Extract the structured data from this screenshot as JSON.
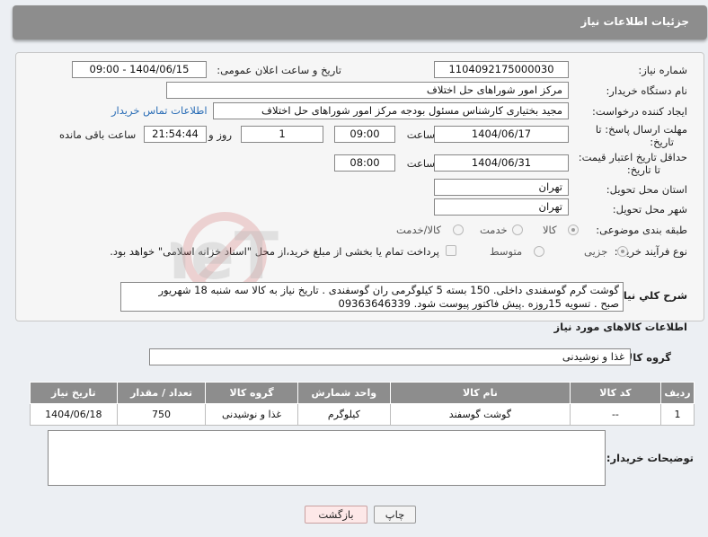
{
  "page_title": "جزئیات اطلاعات نیاز",
  "need_number": {
    "label": "شماره نیاز:",
    "value": "1104092175000030"
  },
  "announce_datetime": {
    "label": "تاریخ و ساعت اعلان عمومی:",
    "value": "1404/06/15 - 09:00"
  },
  "buyer_org": {
    "label": "نام دستگاه خریدار:",
    "value": "مرکز امور شوراهای حل اختلاف"
  },
  "requester": {
    "label": "ایجاد کننده درخواست:",
    "value": "مجید بختیاری کارشناس مسئول بودجه مرکز امور شوراهای حل اختلاف",
    "contact_link": "اطلاعات تماس خریدار"
  },
  "reply_deadline": {
    "label_line1": "مهلت ارسال پاسخ: تا",
    "label_line2": "تاریخ:",
    "date": "1404/06/17",
    "time_label": "ساعت",
    "time": "09:00",
    "days": "1",
    "days_label": "روز و",
    "remaining": "21:54:44",
    "remaining_label": "ساعت باقی مانده"
  },
  "price_validity": {
    "label_line1": "حداقل تاریخ اعتبار قیمت:",
    "label_line2": "تا تاریخ:",
    "date": "1404/06/31",
    "time_label": "ساعت",
    "time": "08:00"
  },
  "delivery_province": {
    "label": "استان محل تحویل:",
    "value": "تهران"
  },
  "delivery_city": {
    "label": "شهر محل تحویل:",
    "value": "تهران"
  },
  "category": {
    "label": "طبقه بندی موضوعی:",
    "options": [
      "کالا",
      "خدمت",
      "کالا/خدمت"
    ],
    "selected": "کالا"
  },
  "process_type": {
    "label": "نوع فرآیند خرید :",
    "options": [
      "جزیی",
      "متوسط"
    ],
    "selected": "جزیی",
    "payment_note": "پرداخت تمام یا بخشی از مبلغ خرید،از محل \"اسناد خزانه اسلامی\" خواهد بود."
  },
  "general_description": {
    "label": "شرح کلي نياز:",
    "line1": "گوشت گرم گوسفندی داخلی. 150 بسته 5 کیلوگرمی ران گوسفندی . تاریخ نیاز به کالا سه شنبه 18 شهریور",
    "line2": "صبح . تسویه 15روزه .پیش فاکتور پیوست شود. 09363646339"
  },
  "goods_info_title": "اطلاعات کالاهای مورد نیاز",
  "goods_group": {
    "label": "گروه کالا:",
    "value": "غذا و نوشیدنی"
  },
  "items_table": {
    "headers": [
      "ردیف",
      "کد کالا",
      "نام کالا",
      "واحد شمارش",
      "گروه کالا",
      "تعداد / مقدار",
      "تاریخ نیاز"
    ],
    "rows": [
      [
        "1",
        "--",
        "گوشت گوسفند",
        "کیلوگرم",
        "غذا و نوشیدنی",
        "750",
        "1404/06/18"
      ]
    ]
  },
  "buyer_notes": {
    "label": "توضیحات خریدار:",
    "value": ""
  },
  "buttons": {
    "print": "چاپ",
    "back": "بازگشت"
  }
}
